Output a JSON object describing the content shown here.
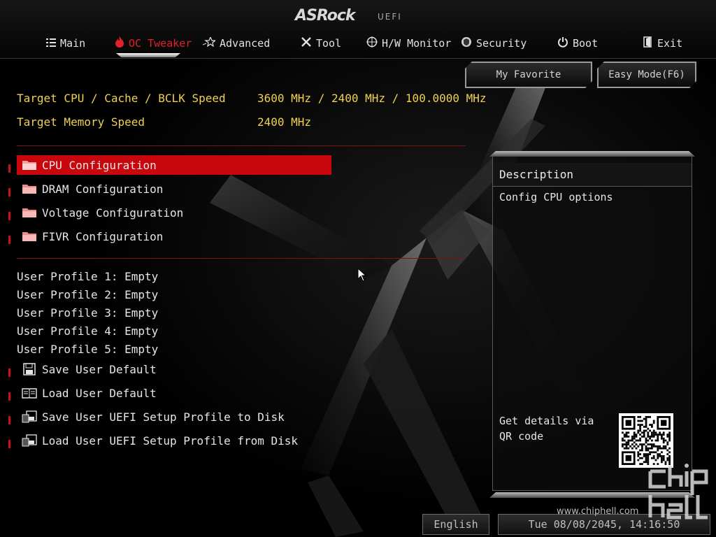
{
  "brand": {
    "logo": "ASRock",
    "tag": "UEFI"
  },
  "nav": {
    "items": [
      {
        "label": "Main",
        "icon": "list-icon"
      },
      {
        "label": "OC Tweaker",
        "icon": "flame-icon",
        "active": true
      },
      {
        "label": "Advanced",
        "icon": "star-icon"
      },
      {
        "label": "Tool",
        "icon": "tools-icon"
      },
      {
        "label": "H/W Monitor",
        "icon": "monitor-icon"
      },
      {
        "label": "Security",
        "icon": "shield-icon"
      },
      {
        "label": "Boot",
        "icon": "power-icon"
      },
      {
        "label": "Exit",
        "icon": "exit-icon"
      }
    ]
  },
  "buttons": {
    "favorite": "My Favorite",
    "easy_mode": "Easy Mode(F6)"
  },
  "targets": {
    "cpu_label": "Target CPU / Cache / BCLK Speed",
    "cpu_value": "3600 MHz / 2400 MHz / 100.0000 MHz",
    "mem_label": "Target Memory Speed",
    "mem_value": "2400 MHz"
  },
  "menu": [
    {
      "label": "CPU Configuration",
      "selected": true
    },
    {
      "label": "DRAM Configuration"
    },
    {
      "label": "Voltage Configuration"
    },
    {
      "label": "FIVR Configuration"
    }
  ],
  "profiles": [
    "User Profile 1: Empty",
    "User Profile 2: Empty",
    "User Profile 3: Empty",
    "User Profile 4: Empty",
    "User Profile 5: Empty"
  ],
  "actions": [
    {
      "label": "Save User Default",
      "icon": "floppy-icon"
    },
    {
      "label": "Load User Default",
      "icon": "book-icon"
    },
    {
      "label": "Save User UEFI Setup Profile to Disk",
      "icon": "disk-save-icon"
    },
    {
      "label": "Load User UEFI Setup Profile from Disk",
      "icon": "disk-load-icon"
    }
  ],
  "description": {
    "title": "Description",
    "text": "Config CPU options",
    "qr_text": "Get details via QR code"
  },
  "bottom": {
    "language": "English",
    "datetime": "Tue 08/08/2045, 14:16:50",
    "watermark": "www.chiphell.com",
    "watermark_logo": "chip hell"
  },
  "colors": {
    "accent_red": "#c8070d",
    "target_yellow": "#f0d050",
    "nav_active": "#e0202a"
  }
}
